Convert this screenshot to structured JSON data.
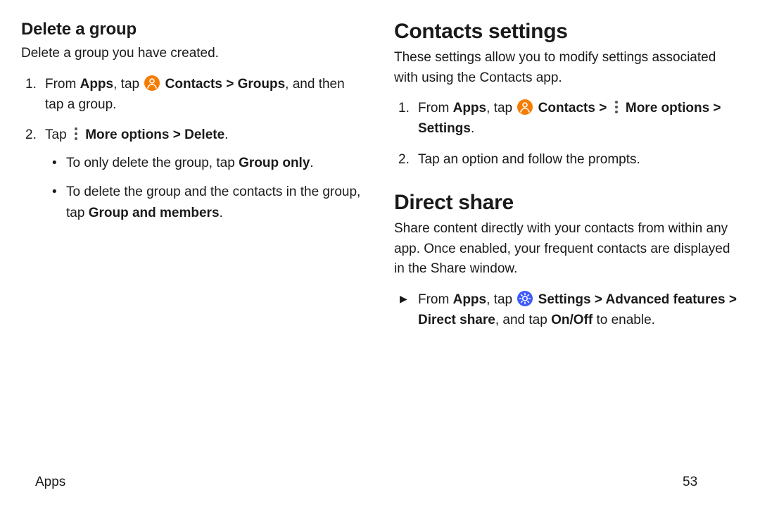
{
  "left": {
    "heading": "Delete a group",
    "intro": "Delete a group you have created.",
    "step1": {
      "pre": "From ",
      "apps": "Apps",
      "tap": ", tap ",
      "contacts": "Contacts",
      "sep": " > ",
      "groups": "Groups",
      "post": ", and then tap a group."
    },
    "step2": {
      "pre": "Tap ",
      "more": "More options",
      "sep": " > ",
      "delete": "Delete",
      "post": ".",
      "sub1_pre": "To only delete the group, tap ",
      "sub1_bold": "Group only",
      "sub1_post": ".",
      "sub2_pre": "To delete the group and the contacts in the group, tap ",
      "sub2_bold": "Group and members",
      "sub2_post": "."
    }
  },
  "right": {
    "heading1": "Contacts settings",
    "intro1": "These settings allow you to modify settings associated with using the Contacts app.",
    "c_step1": {
      "pre": "From ",
      "apps": "Apps",
      "tap": ", tap ",
      "contacts": "Contacts",
      "sep1": " > ",
      "more": "More options",
      "sep2": " > ",
      "settings": "Settings",
      "post": "."
    },
    "c_step2": "Tap an option and follow the prompts.",
    "heading2": "Direct share",
    "intro2": "Share content directly with your contacts from within any app. Once enabled, your frequent contacts are displayed in the Share window.",
    "d_step": {
      "pre": "From ",
      "apps": "Apps",
      "tap": ", tap ",
      "settings": "Settings",
      "sep1": " > ",
      "adv": "Advanced features",
      "sep2": " > ",
      "direct": "Direct share",
      "mid": ", and tap ",
      "onoff": "On/Off",
      "post": " to enable."
    }
  },
  "footer": {
    "section": "Apps",
    "page": "53"
  }
}
